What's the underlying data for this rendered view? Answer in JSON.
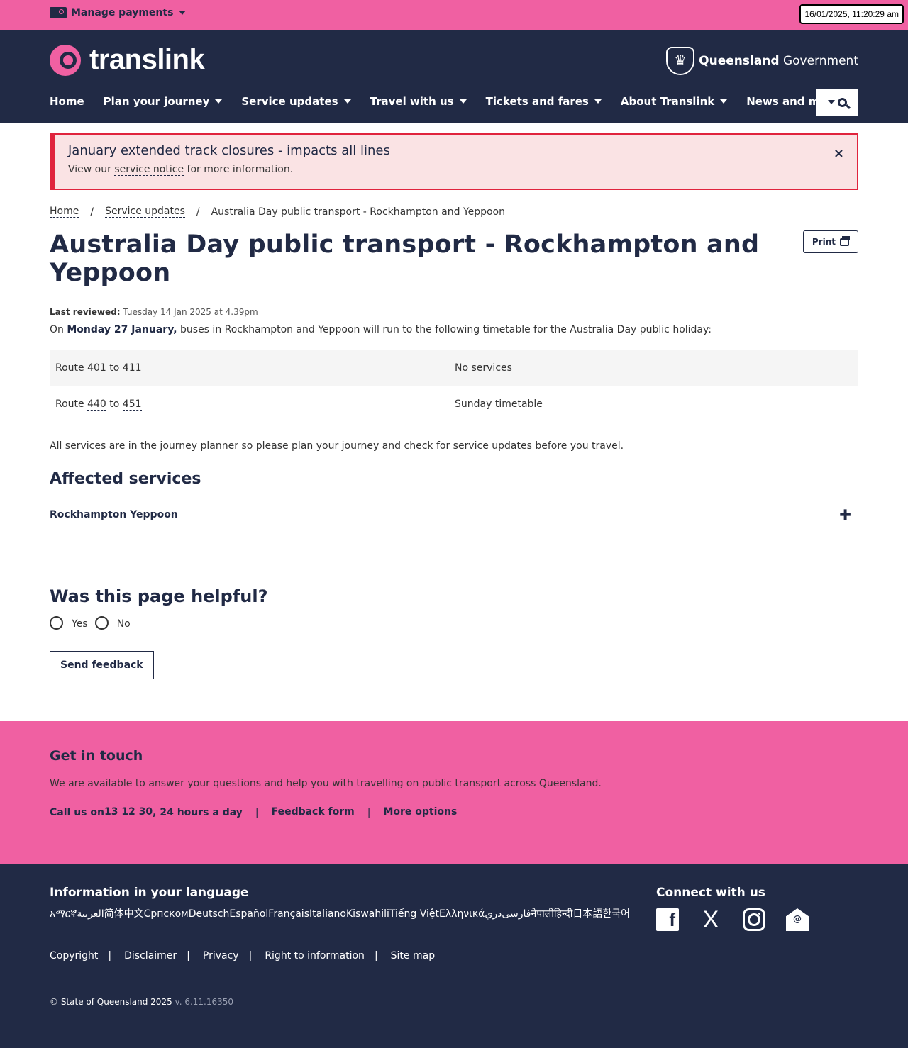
{
  "utility": {
    "manage_payments": "Manage payments",
    "clock": "16/01/2025, 11:20:29 am"
  },
  "header": {
    "logo_text": "translink",
    "gov_bold": "Queensland",
    "gov_rest": " Government",
    "nav": [
      {
        "label": "Home",
        "dropdown": false
      },
      {
        "label": "Plan your journey",
        "dropdown": true
      },
      {
        "label": "Service updates",
        "dropdown": true
      },
      {
        "label": "Travel with us",
        "dropdown": true
      },
      {
        "label": "Tickets and fares",
        "dropdown": true
      },
      {
        "label": "About Translink",
        "dropdown": true
      },
      {
        "label": "News and media",
        "dropdown": true
      }
    ]
  },
  "alert": {
    "title": "January extended track closures - impacts all lines",
    "body_before": "View our ",
    "body_link": "service notice",
    "body_after": " for more information.",
    "close": "×"
  },
  "breadcrumb": {
    "home": "Home",
    "service_updates": "Service updates",
    "current": "Australia Day public transport - Rockhampton and Yeppoon",
    "sep": "/"
  },
  "page": {
    "title": "Australia Day public transport - Rockhampton and Yeppoon",
    "print": "Print",
    "reviewed_label": "Last reviewed:",
    "reviewed_value": " Tuesday 14 Jan 2025 at 4.39pm",
    "intro_before": "On ",
    "intro_bold": "Monday 27 January,",
    "intro_after": " buses in Rockhampton and Yeppoon will run to the following timetable for the Australia Day public holiday:",
    "rows": [
      {
        "prefix": "Route ",
        "from": "401",
        "to_word": " to ",
        "to": "411",
        "status": "No services"
      },
      {
        "prefix": "Route ",
        "from": "440",
        "to_word": " to ",
        "to": "451",
        "status": "Sunday timetable"
      }
    ],
    "all_before": "All services are in the journey planner so please ",
    "all_link1": "plan your journey",
    "all_mid": " and check for ",
    "all_link2": "service updates",
    "all_after": " before you travel.",
    "affected_heading": "Affected services",
    "accordion_label": "Rockhampton Yeppoon",
    "accordion_icon": "✚",
    "helpful_heading": "Was this page helpful?",
    "yes": "Yes",
    "no": "No",
    "send_feedback": "Send feedback"
  },
  "touch": {
    "heading": "Get in touch",
    "sub": "We are available to answer your questions and help you with travelling on public transport across Queensland.",
    "call_before": "Call us on ",
    "phone": "13 12 30",
    "call_after": ", 24 hours a day",
    "feedback": "Feedback form",
    "more": "More options",
    "bar": "|"
  },
  "footer": {
    "lang_heading": "Information in your language",
    "languages": [
      "አማርኛ",
      "العربية",
      "简体中文",
      "Српском",
      "Deutsch",
      "Español",
      "Français",
      "Italiano",
      "Kiswahili",
      "Tiếng Việt",
      "Ελληνικά",
      "دري",
      "فارسی",
      "नेपाली",
      "हिन्दी",
      "日本語",
      "한국어"
    ],
    "connect_heading": "Connect with us",
    "social": {
      "facebook": "f",
      "x": "X",
      "email": "@"
    },
    "legal": [
      "Copyright",
      "Disclaimer",
      "Privacy",
      "Right to information",
      "Site map"
    ],
    "copyright": "© State of Queensland 2025",
    "version": " v. 6.11.16350"
  }
}
